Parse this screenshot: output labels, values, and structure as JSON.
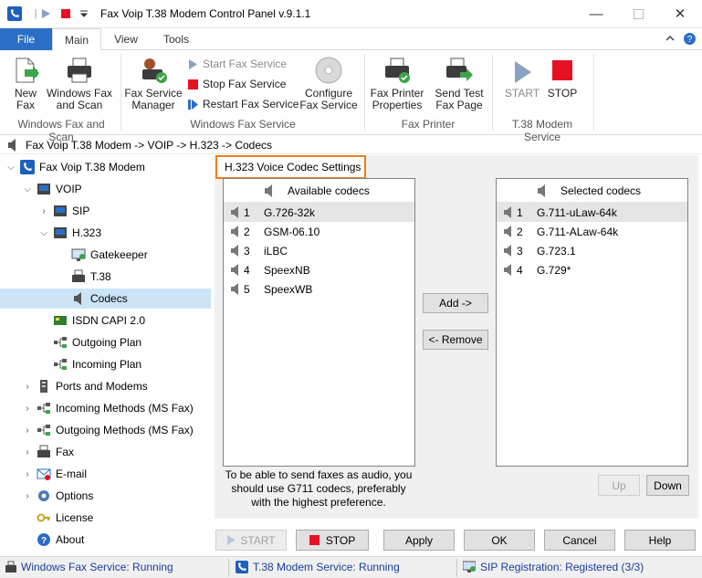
{
  "window": {
    "title": "Fax Voip T.38 Modem Control Panel v.9.1.1"
  },
  "menu_tabs": [
    {
      "label": "File"
    },
    {
      "label": "Main"
    },
    {
      "label": "View"
    },
    {
      "label": "Tools"
    }
  ],
  "ribbon": {
    "new_fax": "New\nFax",
    "windows_fax_scan": "Windows Fax\nand Scan",
    "group_wfs": "Windows Fax and Scan",
    "fax_service_manager": "Fax Service\nManager",
    "start_fax_service": "Start Fax Service",
    "stop_fax_service": "Stop Fax Service",
    "restart_fax_service": "Restart Fax Service",
    "configure_fax_service": "Configure\nFax Service",
    "group_wfsvc": "Windows Fax Service",
    "fax_printer_properties": "Fax Printer\nProperties",
    "send_test_fax_page": "Send Test\nFax Page",
    "group_fax_printer": "Fax Printer",
    "start": "START",
    "stop": "STOP",
    "group_t38": "T.38 Modem Service"
  },
  "breadcrumb": "Fax Voip T.38 Modem -> VOIP -> H.323 -> Codecs",
  "tree": {
    "root": "Fax Voip T.38 Modem",
    "voip": "VOIP",
    "sip": "SIP",
    "h323": "H.323",
    "gatekeeper": "Gatekeeper",
    "t38": "T.38",
    "codecs": "Codecs",
    "isdn": "ISDN CAPI 2.0",
    "outgoing_plan": "Outgoing Plan",
    "incoming_plan": "Incoming Plan",
    "ports": "Ports and Modems",
    "incoming_methods": "Incoming Methods (MS Fax)",
    "outgoing_methods": "Outgoing Methods (MS Fax)",
    "fax": "Fax",
    "email": "E-mail",
    "options": "Options",
    "license": "License",
    "about": "About"
  },
  "panel": {
    "title": "H.323 Voice Codec Settings",
    "available_header": "Available codecs",
    "selected_header": "Selected codecs",
    "available": [
      {
        "index": "1",
        "name": "G.726-32k"
      },
      {
        "index": "2",
        "name": "GSM-06.10"
      },
      {
        "index": "3",
        "name": "iLBC"
      },
      {
        "index": "4",
        "name": "SpeexNB"
      },
      {
        "index": "5",
        "name": "SpeexWB"
      }
    ],
    "selected": [
      {
        "index": "1",
        "name": "G.711-uLaw-64k"
      },
      {
        "index": "2",
        "name": "G.711-ALaw-64k"
      },
      {
        "index": "3",
        "name": "G.723.1"
      },
      {
        "index": "4",
        "name": "G.729*"
      }
    ],
    "add_button": "Add ->",
    "remove_button": "<- Remove",
    "up_button": "Up",
    "down_button": "Down",
    "note": "To be able to send faxes as audio, you should use G711 codecs, preferably with the  highest preference."
  },
  "bottom_buttons": {
    "start": "START",
    "stop": "STOP",
    "apply": "Apply",
    "ok": "OK",
    "cancel": "Cancel",
    "help": "Help"
  },
  "status": {
    "windows_fax": "Windows Fax Service: Running",
    "t38": "T.38 Modem Service: Running",
    "sip": "SIP Registration: Registered (3/3)"
  },
  "colors": {
    "accent": "#2b6ec7",
    "highlight": "#f07d1f",
    "stop_red": "#e81123",
    "selected_tree": "#cce4f7",
    "status_text": "#1a3d9c"
  }
}
